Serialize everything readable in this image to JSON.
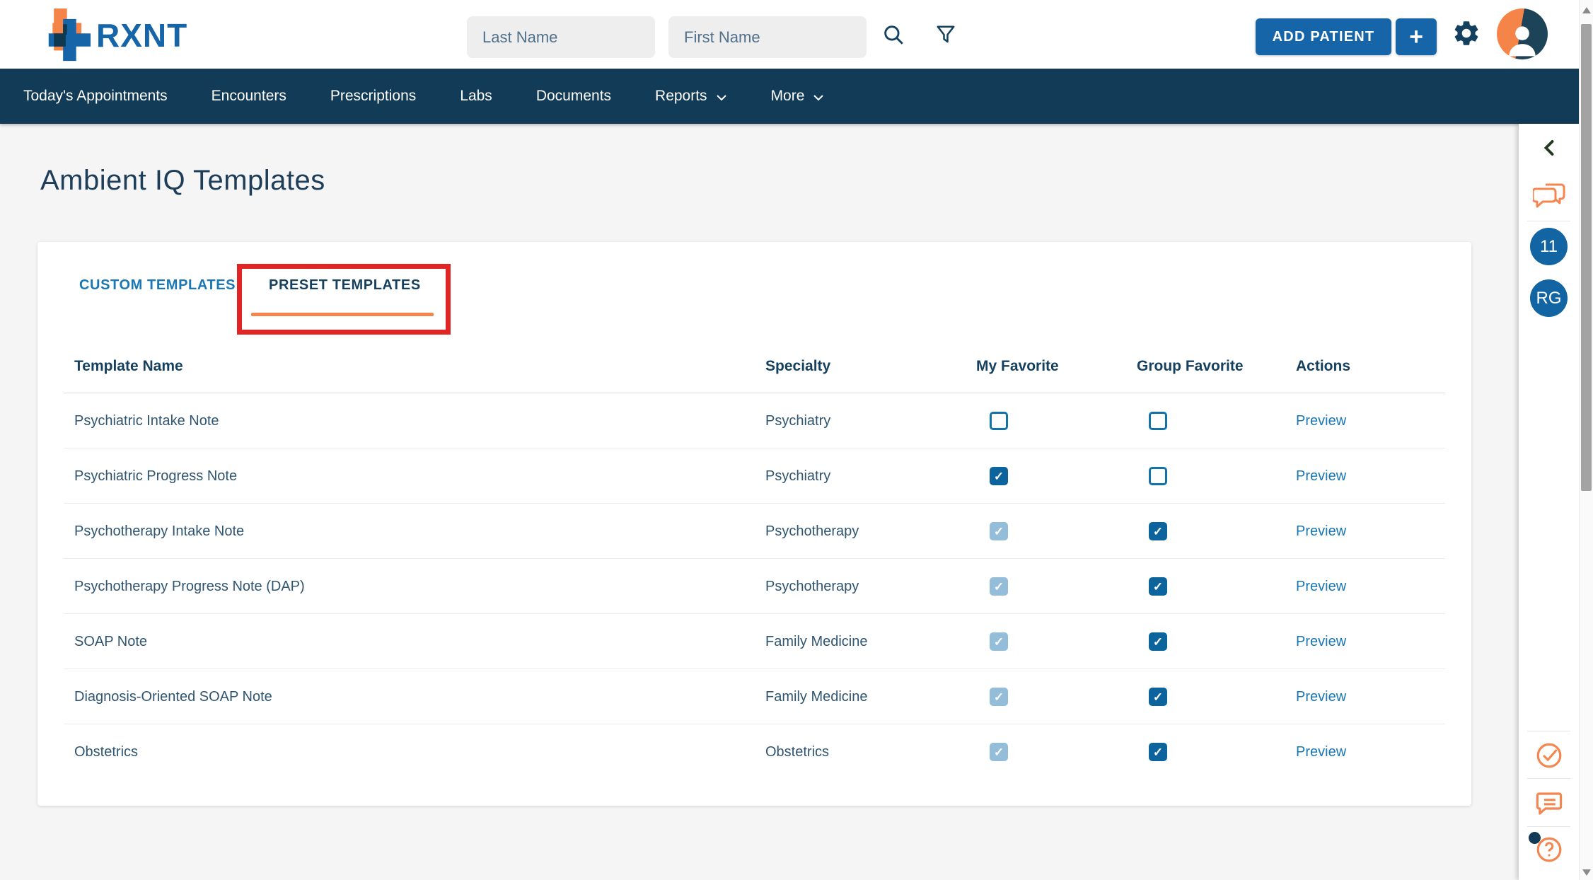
{
  "header": {
    "logo_text": "RXNT",
    "last_name_placeholder": "Last Name",
    "first_name_placeholder": "First Name",
    "add_patient_label": "ADD PATIENT",
    "add_plus_label": "+"
  },
  "nav": {
    "items": [
      {
        "label": "Today's Appointments",
        "dropdown": false
      },
      {
        "label": "Encounters",
        "dropdown": false
      },
      {
        "label": "Prescriptions",
        "dropdown": false
      },
      {
        "label": "Labs",
        "dropdown": false
      },
      {
        "label": "Documents",
        "dropdown": false
      },
      {
        "label": "Reports",
        "dropdown": true
      },
      {
        "label": "More",
        "dropdown": true
      }
    ]
  },
  "page": {
    "title": "Ambient IQ Templates"
  },
  "tabs": {
    "custom_label": "CUSTOM TEMPLATES",
    "preset_label": "PRESET TEMPLATES",
    "active": "PRESET TEMPLATES"
  },
  "table": {
    "columns": [
      "Template Name",
      "Specialty",
      "My Favorite",
      "Group Favorite",
      "Actions"
    ],
    "action_label": "Preview",
    "rows": [
      {
        "name": "Psychiatric Intake Note",
        "specialty": "Psychiatry",
        "my_favorite": "unchecked",
        "group_favorite": "unchecked"
      },
      {
        "name": "Psychiatric Progress Note",
        "specialty": "Psychiatry",
        "my_favorite": "checked",
        "group_favorite": "unchecked"
      },
      {
        "name": "Psychotherapy Intake Note",
        "specialty": "Psychotherapy",
        "my_favorite": "checked-disabled",
        "group_favorite": "checked"
      },
      {
        "name": "Psychotherapy Progress Note (DAP)",
        "specialty": "Psychotherapy",
        "my_favorite": "checked-disabled",
        "group_favorite": "checked"
      },
      {
        "name": "SOAP Note",
        "specialty": "Family Medicine",
        "my_favorite": "checked-disabled",
        "group_favorite": "checked"
      },
      {
        "name": "Diagnosis-Oriented SOAP Note",
        "specialty": "Family Medicine",
        "my_favorite": "checked-disabled",
        "group_favorite": "checked"
      },
      {
        "name": "Obstetrics",
        "specialty": "Obstetrics",
        "my_favorite": "checked-disabled",
        "group_favorite": "checked"
      }
    ]
  },
  "sidebar": {
    "notification_count": "11",
    "user_initials": "RG"
  },
  "colors": {
    "nav_bg": "#113b57",
    "primary_blue": "#1565a8",
    "link_blue": "#1877b4",
    "navy_text": "#16405f",
    "body_text": "#2f5570",
    "orange_accent": "#f5854e",
    "annotation_red": "#e12525",
    "checkbox_checked": "#0d649c",
    "checkbox_disabled": "#93bdd9"
  }
}
